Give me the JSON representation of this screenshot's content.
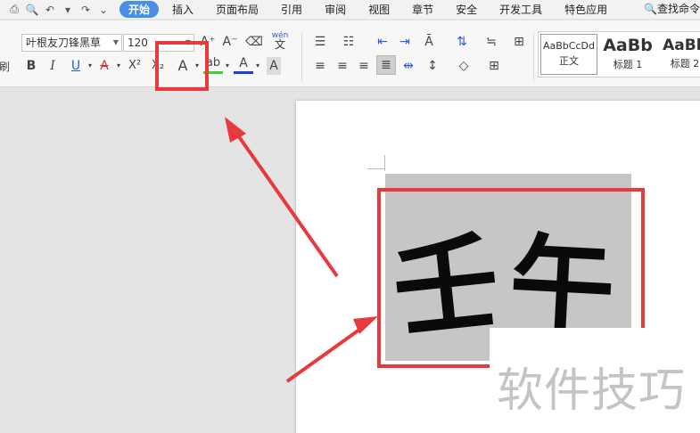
{
  "menubar": {
    "tabs": [
      "开始",
      "插入",
      "页面布局",
      "引用",
      "审阅",
      "视图",
      "章节",
      "安全",
      "开发工具",
      "特色应用"
    ],
    "active_tab": "开始",
    "search_label": "查找命令"
  },
  "ribbon": {
    "font_name": "叶根友刀锋黑草",
    "font_size": "120",
    "left_cut_label": "刷",
    "pinyin_label": "wén",
    "pinyin_char": "文",
    "bold": "B",
    "italic": "I",
    "underline": "U",
    "strike": "A",
    "superscript": "X²",
    "subscript": "X₂",
    "text_effect": "A",
    "highlight": "ab",
    "font_color": "A",
    "char_shade": "A",
    "grow_font": "A⁺",
    "shrink_font": "A⁻",
    "styles": [
      {
        "preview": "AaBbCcDd",
        "label": "正文"
      },
      {
        "preview": "AaBb",
        "label": "标题 1"
      },
      {
        "preview": "AaBb",
        "label": "标题 2"
      }
    ]
  },
  "document": {
    "characters": [
      "壬",
      "午"
    ]
  },
  "watermark": "软件技巧",
  "colors": {
    "accent": "#4a8fe7",
    "annotation": "#e8393d",
    "highlight_bar": "#3bd13b",
    "font_color_bar": "#1a3fd1"
  }
}
